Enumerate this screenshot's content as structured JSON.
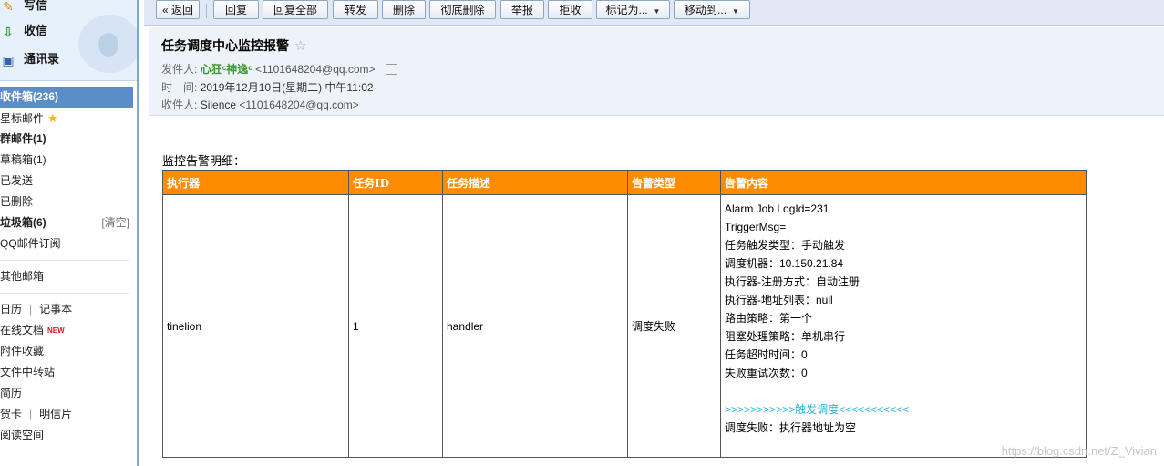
{
  "sidebar": {
    "quick": [
      {
        "icon": "pencil-icon",
        "label": "写信"
      },
      {
        "icon": "inbox-download-icon",
        "label": "收信"
      },
      {
        "icon": "contacts-card-icon",
        "label": "通讯录"
      }
    ],
    "folders": {
      "inbox": "收件箱(236)",
      "starred": "星标邮件",
      "group": "群邮件(1)",
      "drafts": "草稿箱(1)",
      "sent": "已发送",
      "deleted": "已删除",
      "junk": "垃圾箱(6)",
      "junk_clear": "[清空]",
      "subscriptions": "QQ邮件订阅",
      "other_mailboxes": "其他邮箱",
      "calendar": "日历",
      "notes": "记事本",
      "online_docs": "在线文档",
      "new_tag": "NEW",
      "attachments": "附件收藏",
      "file_transfer": "文件中转站",
      "resume": "简历",
      "greeting_card": "贺卡",
      "postcard": "明信片",
      "reading_space": "阅读空间",
      "separator": "|"
    }
  },
  "toolbar": {
    "back": "« 返回",
    "reply": "回复",
    "reply_all": "回复全部",
    "forward": "转发",
    "delete": "删除",
    "delete_permanently": "彻底删除",
    "report": "举报",
    "reject": "拒收",
    "mark_as": "标记为...",
    "move_to": "移动到..."
  },
  "mail": {
    "subject": "任务调度中心监控报警",
    "favorite_icon": "☆",
    "from_label": "发件人:",
    "from_name": "心狂ᶜ神逸ᶜ",
    "from_addr": "<1101648204@qq.com>",
    "time_label": "时　间:",
    "time_value": "2019年12月10日(星期二) 中午11:02",
    "to_label": "收件人:",
    "to_name": "Silence",
    "to_addr": "<1101648204@qq.com>"
  },
  "body": {
    "label": "监控告警明细：",
    "table": {
      "headers": [
        "执行器",
        "任务ID",
        "任务描述",
        "告警类型",
        "告警内容"
      ],
      "row": {
        "executor": "tinelion",
        "task_id": "1",
        "description": "handler",
        "alarm_type": "调度失败",
        "content": [
          "Alarm Job LogId=231",
          "TriggerMsg=",
          "任务触发类型：手动触发",
          "调度机器：10.150.21.84",
          "执行器-注册方式：自动注册",
          "执行器-地址列表：null",
          "路由策略：第一个",
          "阻塞处理策略：单机串行",
          "任务超时时间：0",
          "失败重试次数：0",
          "",
          ">>>>>>>>>>>触发调度<<<<<<<<<<<",
          "调度失败：执行器地址为空"
        ]
      }
    }
  },
  "watermark": "https://blog.csdn.net/Z_Vivian",
  "colors": {
    "table_header": "#ff8c00",
    "active_folder": "#5b8dc9",
    "trigger_line": "#2ab1d9",
    "sender_name": "#3b9a2e"
  }
}
